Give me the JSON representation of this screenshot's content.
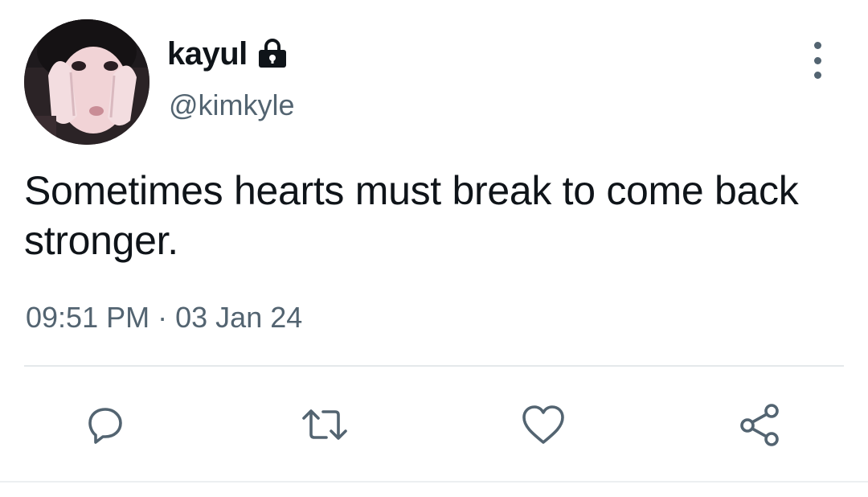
{
  "tweet": {
    "display_name": "kayul",
    "handle": "@kimkyle",
    "text": "Sometimes hearts must break to come back stronger.",
    "time": "09:51 PM",
    "separator": "·",
    "date": "03 Jan 24",
    "protected": true
  },
  "actions": {
    "reply_icon": "reply-icon",
    "retweet_icon": "retweet-icon",
    "like_icon": "heart-icon",
    "share_icon": "share-icon"
  },
  "colors": {
    "primary_text": "#0f1419",
    "secondary_text": "#536471",
    "divider": "#e4e8eb"
  }
}
